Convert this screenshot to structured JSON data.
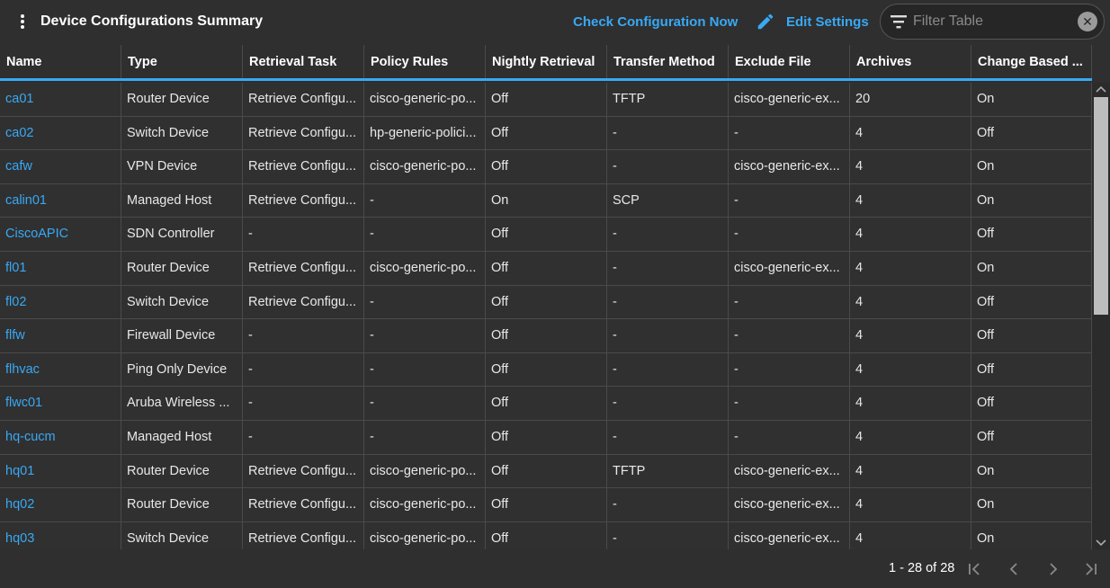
{
  "header": {
    "title": "Device Configurations Summary",
    "check_now_label": "Check Configuration Now",
    "edit_settings_label": "Edit Settings",
    "filter_placeholder": "Filter Table",
    "clear_symbol": "✕"
  },
  "columns": [
    "Name",
    "Type",
    "Retrieval Task",
    "Policy Rules",
    "Nightly Retrieval",
    "Transfer Method",
    "Exclude File",
    "Archives",
    "Change Based ..."
  ],
  "rows": [
    [
      "ca01",
      "Router Device",
      "Retrieve Configu...",
      "cisco-generic-po...",
      "Off",
      "TFTP",
      "cisco-generic-ex...",
      "20",
      "On"
    ],
    [
      "ca02",
      "Switch Device",
      "Retrieve Configu...",
      "hp-generic-polici...",
      "Off",
      "-",
      "-",
      "4",
      "Off"
    ],
    [
      "cafw",
      "VPN Device",
      "Retrieve Configu...",
      "cisco-generic-po...",
      "Off",
      "-",
      "cisco-generic-ex...",
      "4",
      "On"
    ],
    [
      "calin01",
      "Managed Host",
      "Retrieve Configu...",
      "-",
      "On",
      "SCP",
      "-",
      "4",
      "On"
    ],
    [
      "CiscoAPIC",
      "SDN Controller",
      "-",
      "-",
      "Off",
      "-",
      "-",
      "4",
      "Off"
    ],
    [
      "fl01",
      "Router Device",
      "Retrieve Configu...",
      "cisco-generic-po...",
      "Off",
      "-",
      "cisco-generic-ex...",
      "4",
      "On"
    ],
    [
      "fl02",
      "Switch Device",
      "Retrieve Configu...",
      "-",
      "Off",
      "-",
      "-",
      "4",
      "Off"
    ],
    [
      "flfw",
      "Firewall Device",
      "-",
      "-",
      "Off",
      "-",
      "-",
      "4",
      "Off"
    ],
    [
      "flhvac",
      "Ping Only Device",
      "-",
      "-",
      "Off",
      "-",
      "-",
      "4",
      "Off"
    ],
    [
      "flwc01",
      "Aruba Wireless ...",
      "-",
      "-",
      "Off",
      "-",
      "-",
      "4",
      "Off"
    ],
    [
      "hq-cucm",
      "Managed Host",
      "-",
      "-",
      "Off",
      "-",
      "-",
      "4",
      "Off"
    ],
    [
      "hq01",
      "Router Device",
      "Retrieve Configu...",
      "cisco-generic-po...",
      "Off",
      "TFTP",
      "cisco-generic-ex...",
      "4",
      "On"
    ],
    [
      "hq02",
      "Router Device",
      "Retrieve Configu...",
      "cisco-generic-po...",
      "Off",
      "-",
      "cisco-generic-ex...",
      "4",
      "On"
    ],
    [
      "hq03",
      "Switch Device",
      "Retrieve Configu...",
      "cisco-generic-po...",
      "Off",
      "-",
      "cisco-generic-ex...",
      "4",
      "On"
    ]
  ],
  "footer": {
    "page_info": "1 - 28 of 28"
  },
  "colors": {
    "accent": "#38a9f5",
    "background": "#2f2f2f"
  },
  "icons": {
    "menu": "vertical-dots-icon",
    "edit": "pencil-icon",
    "filter": "filter-lines-icon",
    "clear": "close-circle-icon",
    "first": "first-page-icon",
    "prev": "chevron-left-icon",
    "next": "chevron-right-icon",
    "last": "last-page-icon"
  }
}
